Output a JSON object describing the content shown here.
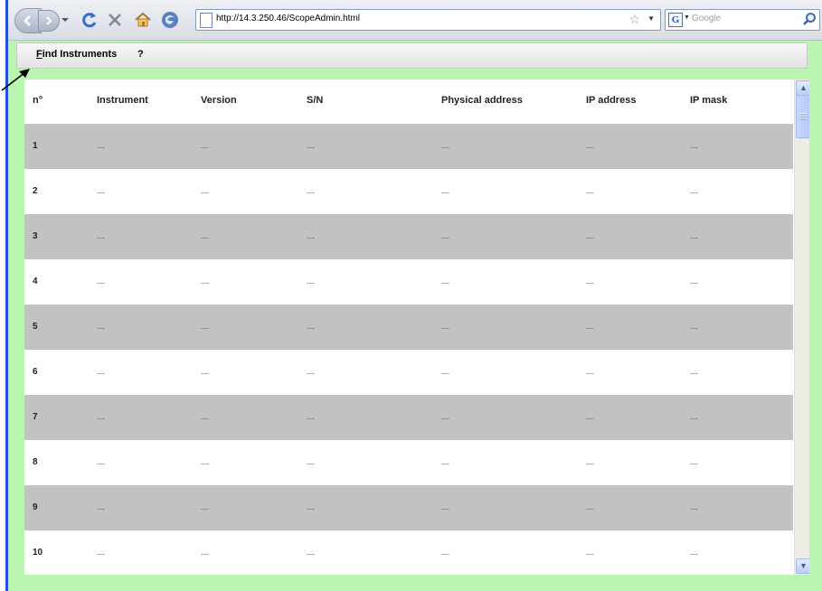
{
  "browser": {
    "url": "http://14.3.250.46/ScopeAdmin.html",
    "search_placeholder": "Google",
    "search_engine_letter": "G"
  },
  "menu": {
    "find_accel": "F",
    "find_rest": "ind Instruments",
    "help": "?"
  },
  "table": {
    "headers": {
      "n": "n°",
      "instrument": "Instrument",
      "version": "Version",
      "sn": "S/N",
      "physical": "Physical address",
      "ip": "IP address",
      "mask": "IP mask"
    },
    "rows": [
      {
        "n": "1",
        "instrument": "---",
        "version": "---",
        "sn": "---",
        "physical": "---",
        "ip": "---",
        "mask": "---"
      },
      {
        "n": "2",
        "instrument": "---",
        "version": "---",
        "sn": "---",
        "physical": "---",
        "ip": "---",
        "mask": "---"
      },
      {
        "n": "3",
        "instrument": "---",
        "version": "---",
        "sn": "---",
        "physical": "---",
        "ip": "---",
        "mask": "---"
      },
      {
        "n": "4",
        "instrument": "---",
        "version": "---",
        "sn": "---",
        "physical": "---",
        "ip": "---",
        "mask": "---"
      },
      {
        "n": "5",
        "instrument": "---",
        "version": "---",
        "sn": "---",
        "physical": "---",
        "ip": "---",
        "mask": "---"
      },
      {
        "n": "6",
        "instrument": "---",
        "version": "---",
        "sn": "---",
        "physical": "---",
        "ip": "---",
        "mask": "---"
      },
      {
        "n": "7",
        "instrument": "---",
        "version": "---",
        "sn": "---",
        "physical": "---",
        "ip": "---",
        "mask": "---"
      },
      {
        "n": "8",
        "instrument": "---",
        "version": "---",
        "sn": "---",
        "physical": "---",
        "ip": "---",
        "mask": "---"
      },
      {
        "n": "9",
        "instrument": "---",
        "version": "---",
        "sn": "---",
        "physical": "---",
        "ip": "---",
        "mask": "---"
      },
      {
        "n": "10",
        "instrument": "---",
        "version": "---",
        "sn": "---",
        "physical": "---",
        "ip": "---",
        "mask": "---"
      }
    ]
  },
  "colors": {
    "page_background": "#b9f5b0",
    "row_alt": "#c2c2c2",
    "window_border": "#1f4fd6"
  }
}
